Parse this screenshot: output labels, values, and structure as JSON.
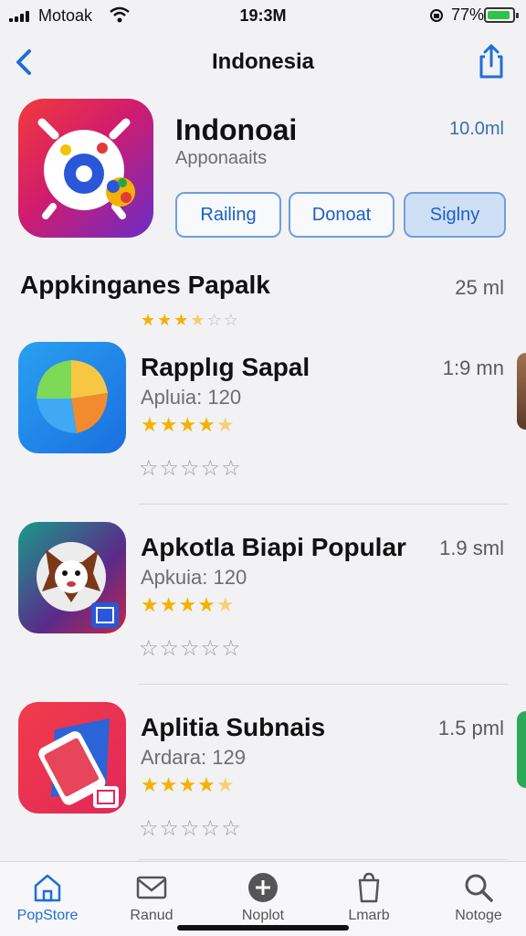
{
  "status_bar": {
    "carrier": "Motoak",
    "time": "19:3M",
    "battery_percent": "77%",
    "battery_color": "#2ec44c"
  },
  "nav": {
    "title": "Indonesia",
    "back_icon": "chevron-left-icon",
    "share_icon": "share-icon"
  },
  "featured_app": {
    "name": "Indonoai",
    "subtitle": "Apponaaits",
    "size": "10.0ml",
    "buttons": [
      {
        "label": "Railing",
        "active": false
      },
      {
        "label": "Donoat",
        "active": false
      },
      {
        "label": "Siglny",
        "active": true
      }
    ]
  },
  "section": {
    "title": "Appkinganes Papalk",
    "meta": "25 ml",
    "rating": 3.5
  },
  "apps": [
    {
      "name": "Rapplıg Sapal",
      "meta": "1:9 mn",
      "sub": "Apluia: 120",
      "rating": 4.5
    },
    {
      "name": "Apkotla Biapi Popular",
      "meta": "1.9 sml",
      "sub": "Apkuia: 120",
      "rating": 4.5
    },
    {
      "name": "Aplitia Subnais",
      "meta": "1.5 pml",
      "sub": "Ardara: 129",
      "rating": 4.5
    }
  ],
  "tabs": [
    {
      "label": "PopStore",
      "icon": "house-icon",
      "active": true
    },
    {
      "label": "Ranud",
      "icon": "mail-icon",
      "active": false
    },
    {
      "label": "Noplot",
      "icon": "add-circle-icon",
      "active": false
    },
    {
      "label": "Lmarb",
      "icon": "bag-icon",
      "active": false
    },
    {
      "label": "Notoge",
      "icon": "search-icon",
      "active": false
    }
  ],
  "colors": {
    "accent": "#1f6fd6",
    "star": "#f5b100"
  }
}
